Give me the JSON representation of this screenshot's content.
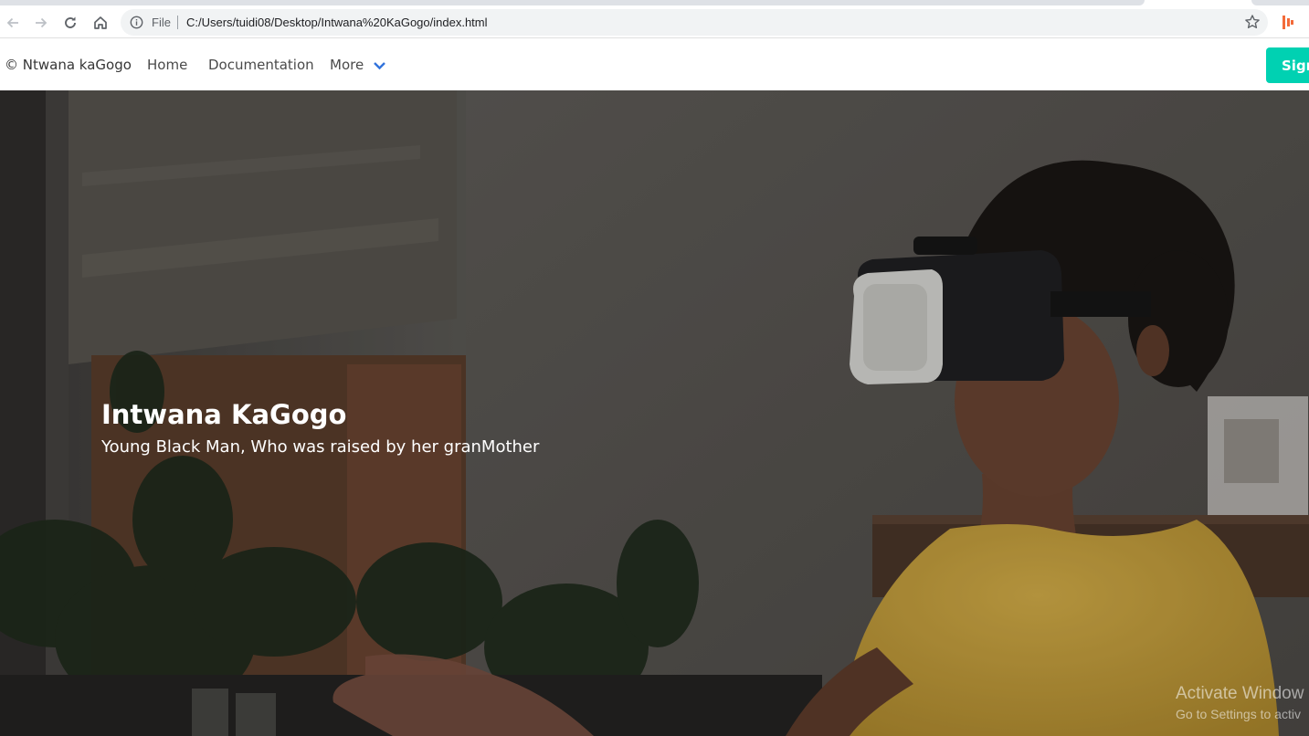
{
  "browser": {
    "scheme_label": "File",
    "url": "C:/Users/tuidi08/Desktop/Intwana%20KaGogo/index.html",
    "icons": [
      "back-arrow-icon",
      "forward-arrow-icon",
      "reload-icon",
      "home-icon",
      "info-icon",
      "star-icon",
      "extension-icon"
    ]
  },
  "navbar": {
    "brand": "© Ntwana kaGogo",
    "links": [
      "Home",
      "Documentation",
      "More"
    ],
    "signup_label": "Sign",
    "accent": "#00d1b2",
    "link_accent": "#3273dc"
  },
  "hero": {
    "title": "Intwana KaGogo",
    "subtitle": "Young Black Man, Who was raised by her granMother"
  },
  "watermark": {
    "line1": "Activate Window",
    "line2": "Go to Settings to activ"
  }
}
